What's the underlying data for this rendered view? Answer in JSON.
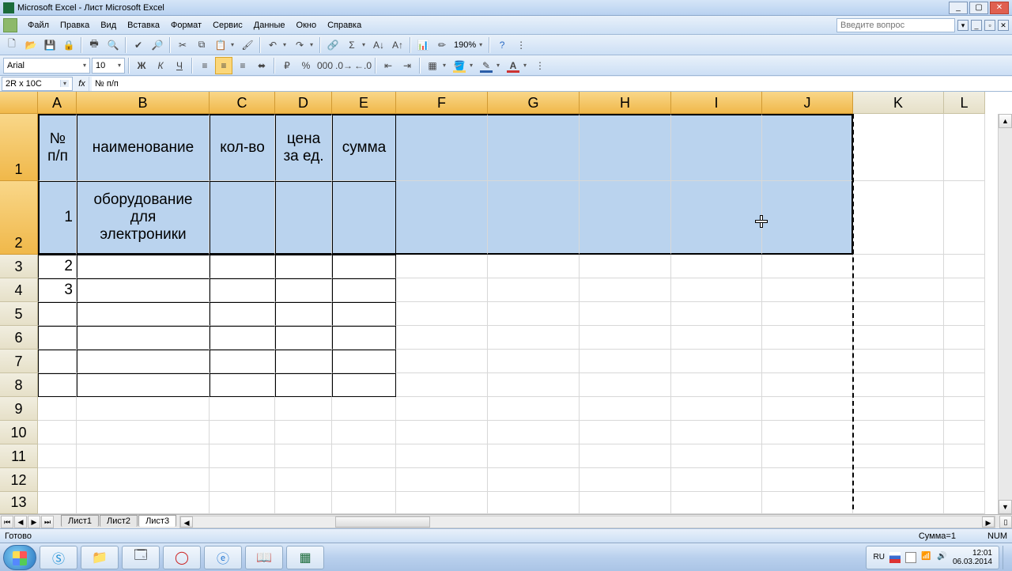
{
  "window": {
    "title": "Microsoft Excel - Лист Microsoft Excel"
  },
  "menu": {
    "items": [
      "Файл",
      "Правка",
      "Вид",
      "Вставка",
      "Формат",
      "Сервис",
      "Данные",
      "Окно",
      "Справка"
    ],
    "search_placeholder": "Введите вопрос"
  },
  "toolbar": {
    "zoom": "190%"
  },
  "format_bar": {
    "font_name": "Arial",
    "font_size": "10"
  },
  "formula_bar": {
    "namebox": "2R x 10C",
    "formula": "№ п/п"
  },
  "columns": {
    "labels": [
      "A",
      "B",
      "C",
      "D",
      "E",
      "F",
      "G",
      "H",
      "I",
      "J",
      "K",
      "L"
    ],
    "widths": [
      49,
      168,
      83,
      72,
      81,
      116,
      116,
      116,
      115,
      115,
      115,
      52
    ],
    "selected_through_index": 9
  },
  "rows": {
    "labels": [
      "1",
      "2",
      "3",
      "4",
      "5",
      "6",
      "7",
      "8",
      "9",
      "10",
      "11",
      "12",
      "13"
    ],
    "heights": [
      85,
      93,
      30,
      30,
      30,
      30,
      30,
      30,
      30,
      30,
      30,
      30,
      28
    ],
    "selected_through_index": 1
  },
  "cells": {
    "r1": {
      "A": "№ п/п",
      "B": "наименование",
      "C": "кол-во",
      "D": "цена за ед.",
      "E": "сумма"
    },
    "r2": {
      "A": "1",
      "B": "оборудование для электроники"
    },
    "r3": {
      "A": "2"
    },
    "r4": {
      "A": "3"
    }
  },
  "sheet_tabs": {
    "tabs": [
      "Лист1",
      "Лист2",
      "Лист3"
    ],
    "active_index": 2
  },
  "status": {
    "left": "Готово",
    "sum": "Сумма=1",
    "num": "NUM"
  },
  "taskbar": {
    "lang": "RU",
    "time": "12:01",
    "date": "06.03.2014"
  },
  "colors": {
    "selection": "#bad3ee",
    "header_sel": "#f0b84a",
    "fill_swatch": "#fbd05a",
    "line_swatch": "#2b5ea8",
    "font_swatch": "#c33"
  }
}
